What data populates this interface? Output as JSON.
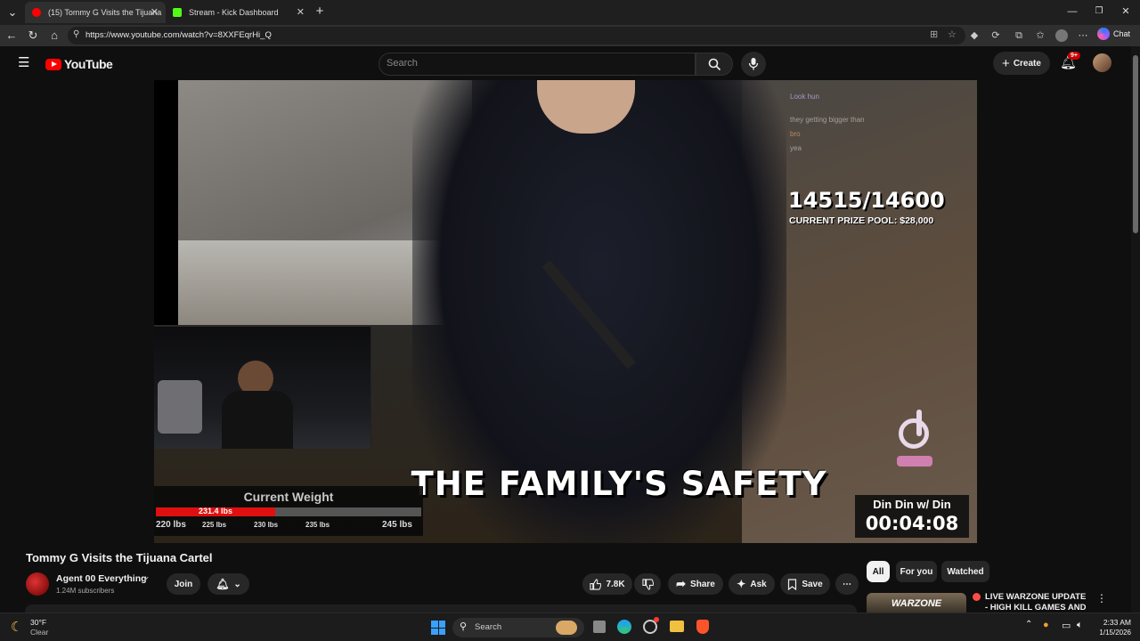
{
  "browser": {
    "tabs": [
      {
        "title": "(15) Tommy G Visits the Tijuana",
        "favicon_color": "#ff0000",
        "active": true
      },
      {
        "title": "Stream - Kick Dashboard",
        "favicon_color": "#53fc18",
        "active": false
      }
    ],
    "new_tab": "+",
    "url": "https://www.youtube.com/watch?v=8XXFEqrHi_Q",
    "chat_label": "Chat"
  },
  "header": {
    "logo_text": "YouTube",
    "search_placeholder": "Search",
    "create_label": "Create",
    "notification_badge": "9+"
  },
  "video": {
    "chat_lines": [
      "Look hun",
      "they getting bigger than",
      "yea",
      "bro"
    ],
    "stats_count": "14515/14600",
    "prize_pool": "CURRENT PRIZE POOL: $28,000",
    "caption": "THE FAMILY'S SAFETY",
    "weight": {
      "title": "Current Weight",
      "current": "231.4 lbs",
      "fill_fraction": 0.45,
      "ticks": [
        "220 lbs",
        "225 lbs",
        "230 lbs",
        "235 lbs",
        "245 lbs"
      ]
    },
    "timer_title": "Din Din w/ Din",
    "timer_value": "00:04:08"
  },
  "below": {
    "title": "Tommy G Visits the Tijuana Cartel",
    "channel_name": "Agent 00 Everything",
    "subscribers": "1.24M subscribers",
    "join_label": "Join",
    "like_count": "7.8K",
    "share_label": "Share",
    "ask_label": "Ask",
    "save_label": "Save",
    "filter_chips": [
      "All",
      "For you",
      "Watched"
    ],
    "rec_title": "LIVE WARZONE UPDATE - HIGH KILL GAMES AND RAGE",
    "rec_thumb_text": "WARZONE"
  },
  "taskbar": {
    "weather_temp": "30°F",
    "weather_desc": "Clear",
    "search_label": "Search",
    "time": "2:33 AM",
    "date": "1/15/2026"
  }
}
